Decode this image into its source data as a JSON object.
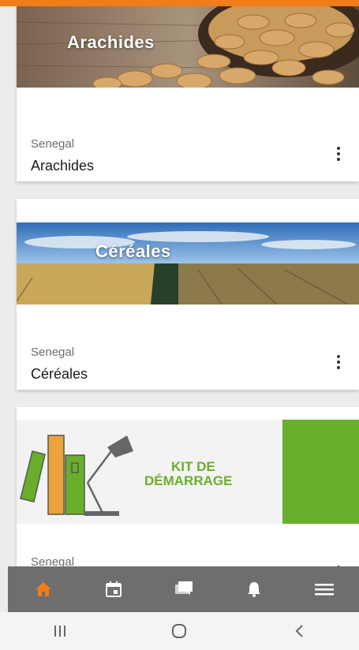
{
  "feed": {
    "cards": [
      {
        "banner_title": "Arachides",
        "country": "Senegal",
        "name": "Arachides"
      },
      {
        "banner_title": "Céréales",
        "country": "Senegal",
        "name": "Céréales"
      },
      {
        "banner_line1": "KIT DE",
        "banner_line2": "DÉMARRAGE",
        "country": "Senegal"
      }
    ]
  },
  "colors": {
    "top_accent": "#f07d1a",
    "nav_bar": "#6e6e6e",
    "nav_active": "#f07d1a",
    "nav_inactive": "#ffffff",
    "kit_green": "#6aaf2b"
  },
  "bottom_nav": {
    "items": [
      {
        "icon": "home-icon",
        "active": true
      },
      {
        "icon": "calendar-icon",
        "active": false
      },
      {
        "icon": "chat-icon",
        "active": false
      },
      {
        "icon": "bell-icon",
        "active": false
      },
      {
        "icon": "hamburger-menu-icon",
        "active": false
      }
    ]
  },
  "system_nav": {
    "items": [
      {
        "icon": "recent-apps-icon"
      },
      {
        "icon": "home-circle-icon"
      },
      {
        "icon": "back-icon"
      }
    ]
  }
}
